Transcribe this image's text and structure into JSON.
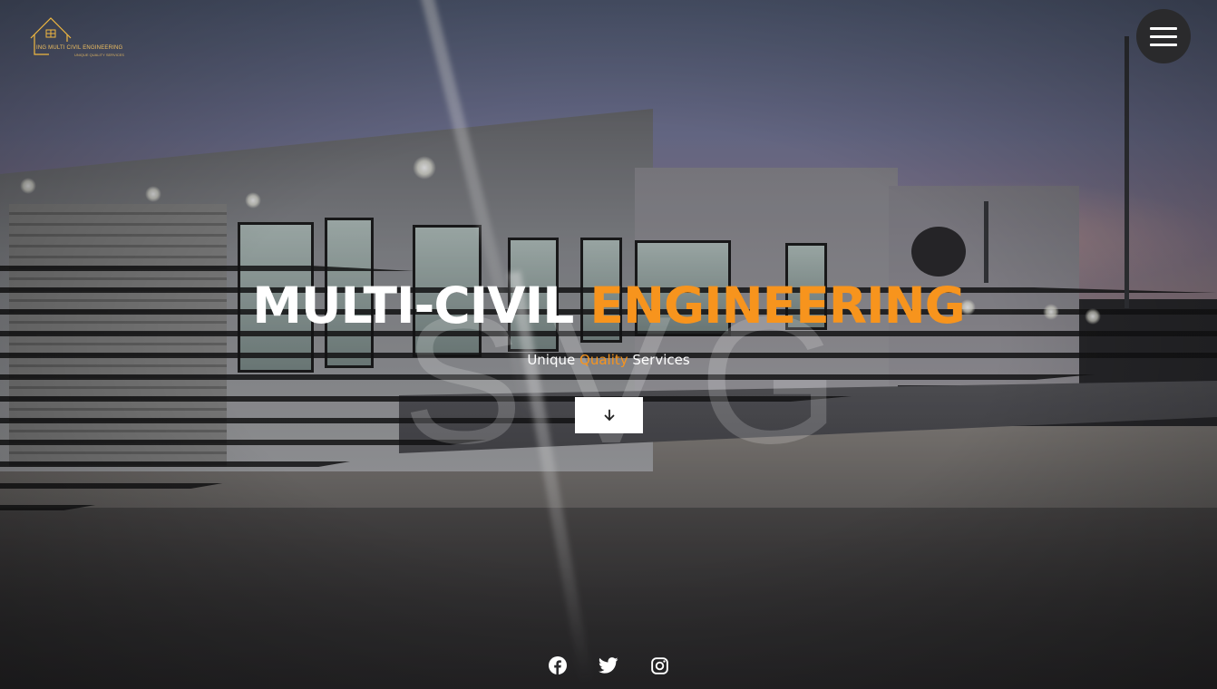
{
  "brand": {
    "logo_text": "ING MULTI CIVIL ENGINEERING",
    "logo_sub": "UNIQUE QUALITY SERVICES",
    "accent_color": "#f7941d"
  },
  "hero": {
    "title_part1": "MULTI-CIVIL",
    "title_part2": "ENGINEERING",
    "tagline_part1": "Unique",
    "tagline_accent": "Quality",
    "tagline_part2": "Services",
    "watermark": "SVG"
  },
  "header": {
    "menu_icon": "hamburger-menu-icon"
  },
  "scroll_button": {
    "icon": "arrow-down-icon"
  },
  "socials": [
    {
      "name": "facebook",
      "icon": "facebook-icon"
    },
    {
      "name": "twitter",
      "icon": "twitter-icon"
    },
    {
      "name": "instagram",
      "icon": "instagram-icon"
    }
  ]
}
